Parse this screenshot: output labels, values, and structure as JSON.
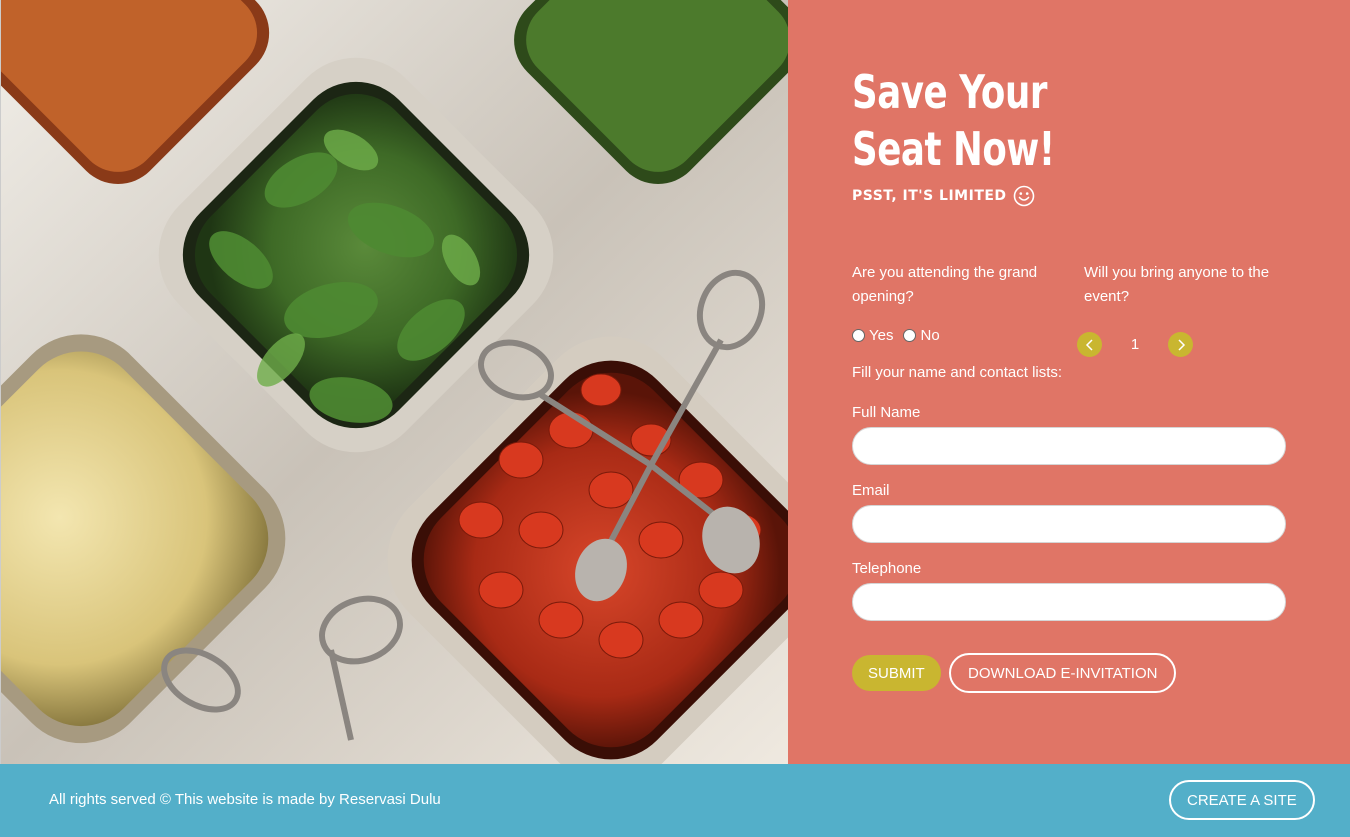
{
  "hero": {
    "image_alt": "salad bar trays with greens, tomatoes, corn and tongs"
  },
  "rsvp": {
    "title_line1": "Save Your",
    "title_line2": "Seat Now!",
    "subtitle": "PSST, IT'S LIMITED",
    "subtitle_icon": "smiley-icon",
    "question_attending": "Are you attending the grand opening?",
    "question_guests": "Will you bring anyone to the event?",
    "attend_options": [
      "Yes",
      "No"
    ],
    "guest_count": "1",
    "fill_label": "Fill your name and contact lists:",
    "fields": {
      "full_name_label": "Full Name",
      "full_name_value": "",
      "email_label": "Email",
      "email_value": "",
      "telephone_label": "Telephone",
      "telephone_value": ""
    },
    "submit_label": "SUBMIT",
    "download_label": "DOWNLOAD E-INVITATION"
  },
  "footer": {
    "text": "All rights served © This website is made by Reservasi Dulu",
    "create_label": "CREATE A SITE"
  },
  "colors": {
    "panel_bg": "#e07566",
    "accent_olive": "#c9b630",
    "footer_bg": "#53afc9",
    "white": "#ffffff"
  }
}
